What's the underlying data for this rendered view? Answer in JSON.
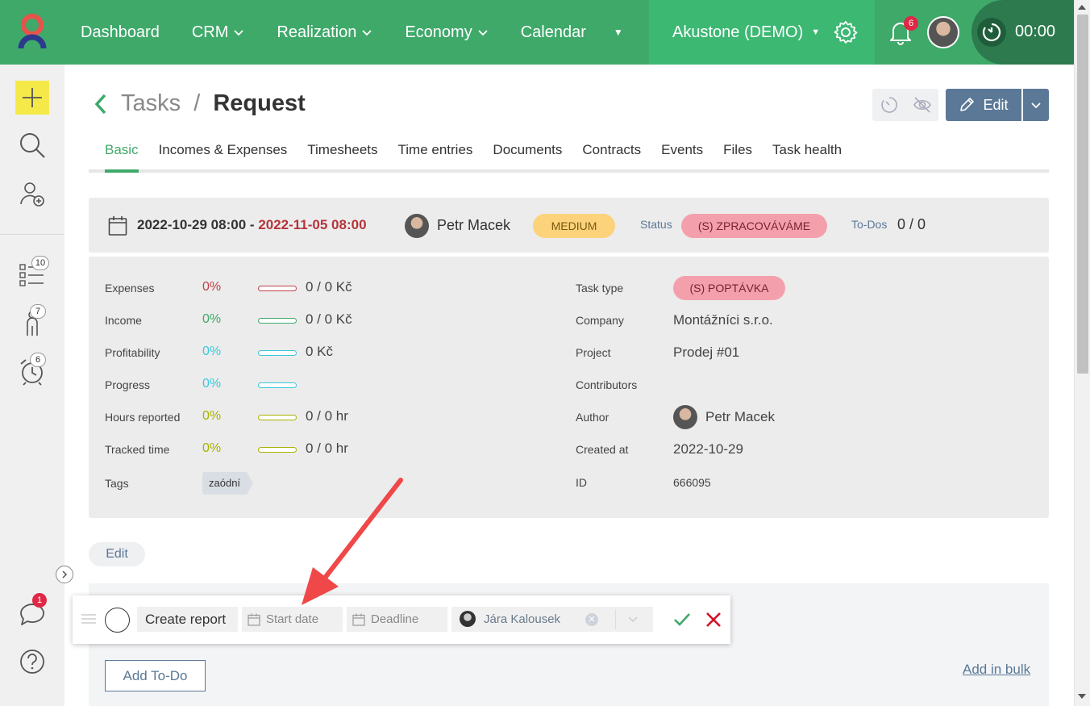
{
  "topbar": {
    "nav": [
      {
        "label": "Dashboard",
        "chevron": false
      },
      {
        "label": "CRM",
        "chevron": true
      },
      {
        "label": "Realization",
        "chevron": true
      },
      {
        "label": "Economy",
        "chevron": true
      },
      {
        "label": "Calendar",
        "chevron": false
      }
    ],
    "company": "Akustone (DEMO)",
    "notifications_count": "6",
    "timer": "00:00"
  },
  "sidebar": {
    "todo_badge": "10",
    "people_badge": "7",
    "alarm_badge": "6",
    "chat_badge": "1"
  },
  "header": {
    "breadcrumb_parent": "Tasks",
    "breadcrumb_sep": "/",
    "title": "Request",
    "edit_label": "Edit"
  },
  "tabs": [
    "Basic",
    "Incomes & Expenses",
    "Timesheets",
    "Time entries",
    "Documents",
    "Contracts",
    "Events",
    "Files",
    "Task health"
  ],
  "info": {
    "start": "2022-10-29 08:00",
    "dash": "-",
    "deadline": "2022-11-05 08:00",
    "user": "Petr Macek",
    "priority": "MEDIUM",
    "status_label": "Status",
    "status": "(S) ZPRACOVÁVÁME",
    "todos_label": "To-Dos",
    "todos_value": "0 / 0"
  },
  "metrics": [
    {
      "label": "Expenses",
      "pct": "0%",
      "value": "0 / 0 Kč",
      "color": "#c0424a",
      "fill": 0
    },
    {
      "label": "Income",
      "pct": "0%",
      "value": "0 / 0 Kč",
      "color": "#3fa96a",
      "fill": 0
    },
    {
      "label": "Profitability",
      "pct": "0%",
      "value": "0 Kč",
      "color": "#3cc8dc",
      "fill": 0
    },
    {
      "label": "Progress",
      "pct": "0%",
      "value": "",
      "color": "#3cc8dc",
      "fill": 0
    },
    {
      "label": "Hours reported",
      "pct": "0%",
      "value": "0 / 0 hr",
      "color": "#a9b200",
      "fill": 0
    },
    {
      "label": "Tracked time",
      "pct": "0%",
      "value": "0 / 0 hr",
      "color": "#a9b200",
      "fill": 0
    }
  ],
  "tags_label": "Tags",
  "tag": "zaódní",
  "right_fields": {
    "task_type_label": "Task type",
    "task_type": "(S) POPTÁVKA",
    "company_label": "Company",
    "company": "Montážníci s.r.o.",
    "project_label": "Project",
    "project": "Prodej #01",
    "contributors_label": "Contributors",
    "author_label": "Author",
    "author": "Petr Macek",
    "created_label": "Created at",
    "created": "2022-10-29",
    "id_label": "ID",
    "id": "666095"
  },
  "edit_link": "Edit",
  "todo_form": {
    "name": "Create report",
    "start_placeholder": "Start date",
    "deadline_placeholder": "Deadline",
    "assignee": "Jára Kalousek"
  },
  "add_todo": "Add To-Do",
  "add_bulk": "Add in bulk",
  "colors": {
    "topbar": "#3fa96a",
    "accent": "#3fa96a",
    "button": "#5b7896",
    "danger": "#d0142c"
  }
}
